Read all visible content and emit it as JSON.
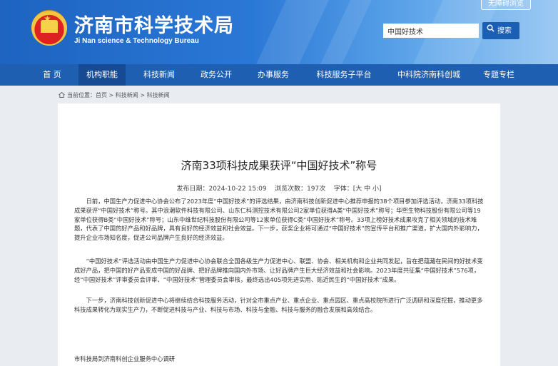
{
  "header": {
    "site_title": "济南市科学技术局",
    "site_subtitle": "Ji Nan science & Technology Bureau",
    "accessibility_label": "无障碍浏览",
    "search_value": "中国好技术",
    "search_button": "搜索",
    "brand_color": "#1f5fb2"
  },
  "nav": {
    "items": [
      {
        "label": "首 页"
      },
      {
        "label": "机构职能"
      },
      {
        "label": "科技新闻"
      },
      {
        "label": "政务公开"
      },
      {
        "label": "办事服务"
      },
      {
        "label": "科技服务子平台"
      },
      {
        "label": "中科院济南科创城"
      },
      {
        "label": "专题专栏"
      }
    ],
    "active_index": 1
  },
  "breadcrumb": {
    "prefix": "当前位置：",
    "items": [
      "首页",
      "科技新闻",
      "科技新闻"
    ],
    "separator": " > "
  },
  "article": {
    "title": "济南33项科技成果获评“中国好技术”称号",
    "publish_label": "发布日期：",
    "publish_date": "2024-10-22 15:09",
    "views_label": "浏览次数：",
    "views": "197次",
    "font_label": "字体：[",
    "font_large": "大",
    "font_medium": "中",
    "font_small": "小",
    "font_close": "]",
    "paragraphs": [
      "日前，中国生产力促进中心协会公布了2023年度“中国好技术”的评选结果，由济南科技创新促进中心推荐申报的38个项目参加评选活动，济南33项科技成果获评“中国好技术”称号。其中浪潮软件科技有限公司、山东仁科测控技术有限公司2家单位获得A类“中国好技术”称号；华熙生物科技股份有限公司等19家单位获得B类“中国好技术”称号；山东中维世纪科技股份有限公司等12家单位获得C类“中国好技术”称号。33项上榜好技术成果攻克了相关领域的技术难题，代表了中国的好产品和好品牌，具有良好的经济效益和社会效益。下一步，获奖企业将可通过“中国好技术”的宣传平台和推广渠道，扩大国内外影响力，提升企业市场知名度，促进公司品牌产生良好的经济效益。",
      "“中国好技术”评选活动由中国生产力促进中心协会联合全国各级生产力促进中心、联盟、协会、相关机构和企业共同发起，旨在把蕴藏在民间的好技术变成好产品，把中国的好产品变成中国的好品牌、把好品牌推向国内外市场、让好品牌产生巨大经济效益和社会影响。2023年度共征集“中国好技术”576项，经“中国好技术”评审委员会评审、“中国好技术”管理委员会审核，最终选出405项先进实用、贴近民生的“中国好技术”成果。",
      "下一步，济南科技创新促进中心将继续结合科技服务活动，针对全市重点产业、重点企业、重点园区、重点高校院所进行广泛调研和深度挖掘，推动更多科技成果转化为现实生产力，不断促进科技与产业、科技与市场、科技与金融、科技与服务的融合发展和高效结合。"
    ],
    "footer_note": "市科技局到济南科创企业服务中心调研"
  }
}
